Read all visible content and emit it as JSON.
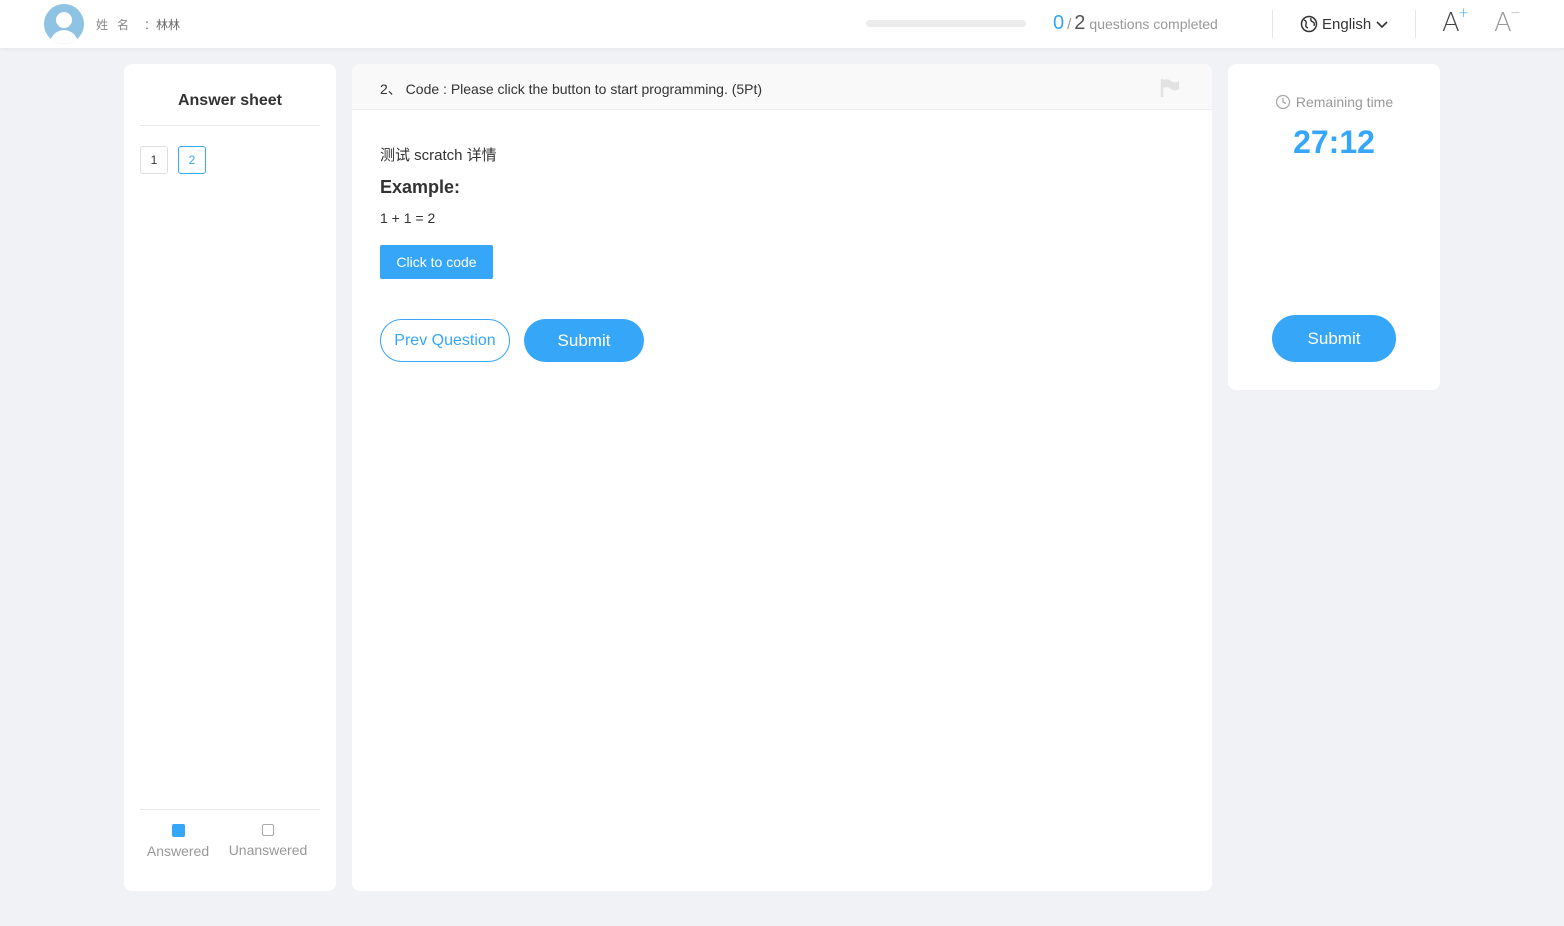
{
  "header": {
    "name_label": "姓名",
    "name_sep": "：",
    "name_value": "林林",
    "progress": {
      "completed": "0",
      "slash": "/",
      "total": "2",
      "suffix": "questions completed",
      "fraction": 0
    },
    "language": "English",
    "font_increase_icon": "font-increase-icon",
    "font_decrease_icon": "font-decrease-icon"
  },
  "answer_sheet": {
    "title": "Answer sheet",
    "questions": [
      "1",
      "2"
    ],
    "current": "2",
    "legend": {
      "answered": "Answered",
      "unanswered": "Unanswered"
    }
  },
  "question": {
    "title": "2、 Code : Please click the button to start programming. (5Pt)",
    "description": "测试 scratch 详情",
    "example_label": "Example:",
    "formula": "1 + 1 = 2",
    "code_button": "Click to code",
    "prev_button": "Prev Question",
    "submit_button": "Submit"
  },
  "timer": {
    "label": "Remaining time",
    "value": "27:12",
    "submit_button": "Submit"
  },
  "colors": {
    "accent": "#36a6f9",
    "background": "#f0f2f5"
  }
}
